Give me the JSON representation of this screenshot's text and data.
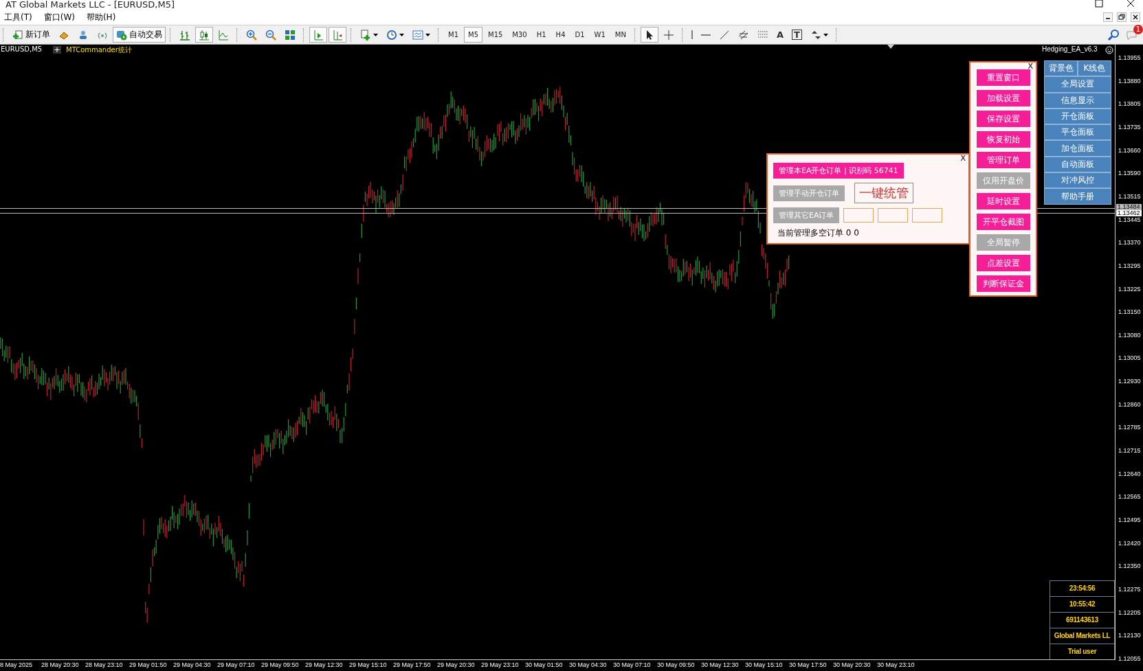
{
  "window": {
    "title": "AT Global Markets LLC - [EURUSD,M5]"
  },
  "menu": [
    "工具(T)",
    "窗口(W)",
    "帮助(H)"
  ],
  "toolbar": {
    "groups": [
      [
        {
          "kind": "new_order",
          "label": "新订单",
          "pressed": false
        },
        {
          "kind": "gold",
          "pressed": false
        },
        {
          "kind": "person",
          "pressed": false
        },
        {
          "kind": "signal",
          "pressed": false
        },
        {
          "kind": "auto_trading",
          "label": "自动交易",
          "pressed": true
        }
      ],
      [
        {
          "kind": "bar_chart",
          "pressed": false
        },
        {
          "kind": "candles",
          "pressed": true
        },
        {
          "kind": "line_chart",
          "pressed": false
        }
      ],
      [
        {
          "kind": "zoom_in",
          "pressed": false
        },
        {
          "kind": "zoom_out",
          "pressed": false
        },
        {
          "kind": "tile",
          "pressed": false
        }
      ],
      [
        {
          "kind": "auto_scroll",
          "pressed": true
        },
        {
          "kind": "chart_shift",
          "pressed": true
        }
      ],
      [
        {
          "kind": "indicators",
          "pressed": false,
          "dropdown": true
        },
        {
          "kind": "clock",
          "pressed": false,
          "dropdown": true
        },
        {
          "kind": "template",
          "pressed": false,
          "dropdown": true
        }
      ]
    ],
    "timeframes": [
      {
        "label": "M1",
        "selected": false
      },
      {
        "label": "M5",
        "selected": true
      },
      {
        "label": "M15",
        "selected": false
      },
      {
        "label": "M30",
        "selected": false
      },
      {
        "label": "H1",
        "selected": false
      },
      {
        "label": "H4",
        "selected": false
      },
      {
        "label": "D1",
        "selected": false
      },
      {
        "label": "W1",
        "selected": false
      },
      {
        "label": "MN",
        "selected": false
      }
    ],
    "drawing_groups": [
      [
        {
          "kind": "cursor",
          "pressed": true
        },
        {
          "kind": "crosshair",
          "pressed": false
        }
      ],
      [
        {
          "kind": "vline",
          "pressed": false
        },
        {
          "kind": "hline",
          "pressed": false
        },
        {
          "kind": "trendline",
          "pressed": false
        },
        {
          "kind": "channel",
          "pressed": false
        },
        {
          "kind": "fibo",
          "pressed": false
        },
        {
          "kind": "text",
          "label": "A",
          "pressed": false
        },
        {
          "kind": "label",
          "label": "T",
          "pressed": false
        },
        {
          "kind": "arrows",
          "pressed": false,
          "dropdown": true
        }
      ]
    ],
    "notification_count": "1"
  },
  "chart": {
    "symbol": "EURUSD,M5",
    "indicator": "MTCommander统计",
    "ea_label": "Hedging_EA_v6.3",
    "price_ticks": [
      "1.13955",
      "1.13880",
      "1.13805",
      "1.13735",
      "1.13660",
      "1.13590",
      "1.13515",
      "1.13445",
      "1.13370",
      "1.13295",
      "1.13225",
      "1.13150",
      "1.13080",
      "1.13005",
      "1.12930",
      "1.12860",
      "1.12785",
      "1.12715",
      "1.12640",
      "1.12565",
      "1.12495",
      "1.12420",
      "1.12350",
      "1.12275",
      "1.12205",
      "1.12130",
      "1.12055"
    ],
    "price_tags": [
      "1.13484",
      "1.13462"
    ],
    "time_ticks": [
      "8 May 2025",
      "28 May 20:30",
      "28 May 23:10",
      "29 May 01:50",
      "29 May 04:30",
      "29 May 07:10",
      "29 May 09:50",
      "29 May 12:30",
      "29 May 15:10",
      "29 May 17:50",
      "29 May 20:30",
      "29 May 23:10",
      "30 May 01:50",
      "30 May 04:30",
      "30 May 07:10",
      "30 May 09:50",
      "30 May 12:30",
      "30 May 15:10",
      "30 May 17:50",
      "30 May 20:30",
      "30 May 23:10"
    ]
  },
  "color_tabs": [
    "背景色",
    "K线色"
  ],
  "panel_menu": [
    "全局设置",
    "信息显示",
    "开仓面板",
    "平仓面板",
    "加仓面板",
    "自动面板",
    "对冲风控",
    "帮助手册"
  ],
  "control_panel": {
    "close": "X",
    "buttons": [
      {
        "label": "重置窗口",
        "active": true
      },
      {
        "label": "加载设置",
        "active": true
      },
      {
        "label": "保存设置",
        "active": true
      },
      {
        "label": "恢复初始",
        "active": true
      },
      {
        "label": "管理订单",
        "active": true
      },
      {
        "label": "仅用开盘价",
        "active": false
      },
      {
        "label": "延时设置",
        "active": true
      },
      {
        "label": "开平仓截图",
        "active": true
      },
      {
        "label": "全局暂停",
        "active": false
      },
      {
        "label": "点差设置",
        "active": true
      },
      {
        "label": "判断保证金",
        "active": true
      }
    ]
  },
  "manage_panel": {
    "close": "X",
    "options": [
      {
        "label": "管理本EA开仓订单 | 识别码 56741",
        "selected": true
      },
      {
        "label": "管理手动开仓订单",
        "selected": false
      },
      {
        "label": "管理其它EA订单",
        "selected": false
      }
    ],
    "one_click": "一键统管",
    "status": "当前管理多空订单 0 0"
  },
  "info_box": [
    "23:54:56",
    "10:55:42",
    "691143613",
    "Global Markets LL",
    "Trial user"
  ]
}
